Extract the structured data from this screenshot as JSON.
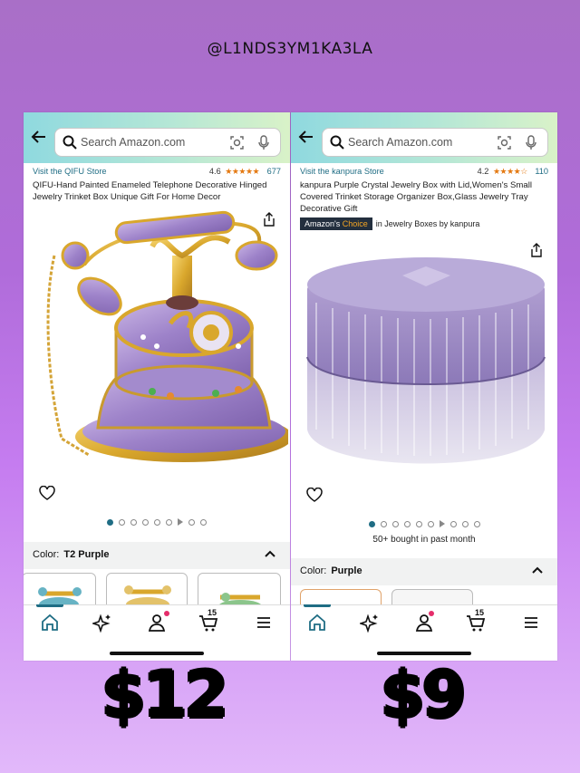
{
  "handle": "@L1NDS3YM1KA3LA",
  "search_placeholder": "Search Amazon.com",
  "left": {
    "store": "Visit the QIFU Store",
    "rating": "4.6",
    "stars": "★★★★★",
    "rating_count": "677",
    "title": "QIFU-Hand Painted Enameled Telephone Decorative Hinged Jewelry Trinket Box Unique Gift For Home Decor",
    "color_label": "Color:",
    "color_value": "T2 Purple",
    "price": "$12"
  },
  "right": {
    "store": "Visit the kanpura Store",
    "rating": "4.2",
    "stars": "★★★★☆",
    "rating_count": "110",
    "title": "kanpura Purple Crystal Jewelry Box with Lid,Women's Small Covered Trinket Storage Organizer Box,Glass Jewelry Tray Decorative Gift",
    "badge_prefix": "Amazon's",
    "badge_choice": "Choice",
    "badge_suffix": "in Jewelry Boxes by kanpura",
    "bought": "50+ bought in past month",
    "color_label": "Color:",
    "color_value": "Purple",
    "price": "$9"
  },
  "cart_count": "15",
  "colors": {
    "accent": "#1f6d84",
    "star": "#e47911",
    "badge_bg": "#232f3e",
    "badge_choice": "#f5a623",
    "notif": "#e52d6b"
  }
}
